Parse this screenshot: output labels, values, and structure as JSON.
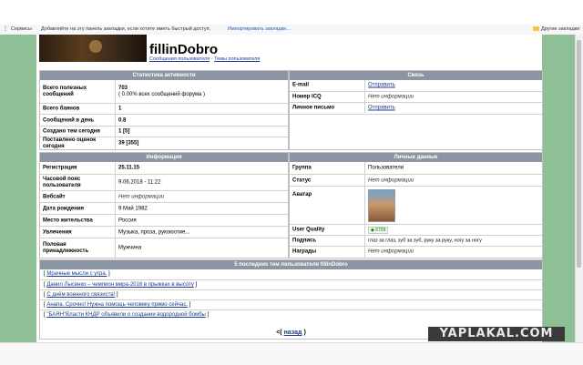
{
  "bookmarks": {
    "services_label": "Сервисы",
    "hint": "Добавляйте на эту панель закладки, если хотите иметь быстрый доступ.",
    "import_link": "Импортировать закладки...",
    "other_label": "Другие закладки"
  },
  "profile": {
    "username": "fillinDobro",
    "user_posts_link": "Сообщения пользователя",
    "separator": "·",
    "user_topics_link": "Темы пользователя"
  },
  "stats": {
    "header": "Статистика активности",
    "rows": [
      {
        "label": "Всего полезных сообщений",
        "value": "703",
        "sub": "( 0.00% всех сообщений форума )"
      },
      {
        "label": "Всего баянов",
        "value": "1"
      },
      {
        "label": "Сообщений в день",
        "value": "0.8"
      },
      {
        "label": "Создано тем сегодня",
        "value": "1 [5]"
      },
      {
        "label": "Поставлено оценок сегодня",
        "value": "39 [355]"
      }
    ]
  },
  "contact": {
    "header": "Связь",
    "rows": [
      {
        "label": "E-mail",
        "value": "Отправить"
      },
      {
        "label": "Номер ICQ",
        "value": "Нет информации"
      },
      {
        "label": "Личное письмо",
        "value": "Отправить"
      }
    ]
  },
  "info": {
    "header": "Информация",
    "rows": [
      {
        "label": "Регистрация",
        "value": "25.11.15"
      },
      {
        "label": "Часовой пояс пользователя",
        "value": "9.06.2018 - 11:22"
      },
      {
        "label": "Вебсайт",
        "value": "Нет информации"
      },
      {
        "label": "Дата рождения",
        "value": "9 Май 1982"
      },
      {
        "label": "Место жительства",
        "value": "Россия"
      },
      {
        "label": "Увлечения",
        "value": "Музыка, проза, рукоюотие..."
      },
      {
        "label": "Половая принадлежность",
        "value": "Мужчина"
      }
    ]
  },
  "personal": {
    "header": "Личные данные",
    "rows": [
      {
        "label": "Группа",
        "value": "Пользователи"
      },
      {
        "label": "Статус",
        "value": "Нет информации"
      },
      {
        "label": "Аватар",
        "value": ""
      },
      {
        "label": "User Quality",
        "value": "6709"
      },
      {
        "label": "Подпись",
        "value": "глаз за глаз, зуб за зуб, руку за руку, ногу за ногу"
      },
      {
        "label": "Награды",
        "value": "Нет информации"
      }
    ]
  },
  "topics": {
    "header": "5 последних тем пользователя fillinDobro",
    "items": [
      "Мрачные мысли с утра.",
      "Данил Лысенко – чемпион мира-2018 в прыжках в высоту",
      "С днём военного связиста!",
      "Анапа. Срочно! Нужна помощь человеку прямо сейчас.",
      "\"БАЯН\"Власти КНДР объявили о создании водородной бомбы"
    ],
    "back_prefix": "<(",
    "back_link": "назад",
    "back_suffix": ")"
  },
  "watermark": "YAPLAKAL.COM",
  "colors": {
    "panel_header": "#8b95a3",
    "side_green": "#8fbf95",
    "link": "#1a3c8c"
  }
}
